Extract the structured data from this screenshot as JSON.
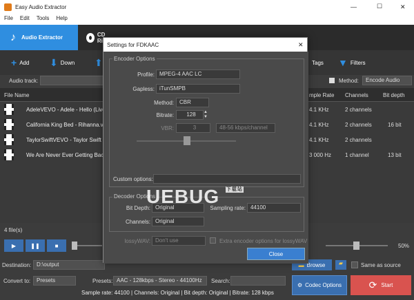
{
  "window": {
    "title": "Easy Audio Extractor",
    "minimize": "—",
    "maximize": "☐",
    "close": "✕"
  },
  "menu": [
    "File",
    "Edit",
    "Tools",
    "Help"
  ],
  "tabs": {
    "audio_extractor": "Audio Extractor",
    "cd_ripper": "CD Ri"
  },
  "toolbar": {
    "add": "Add",
    "down": "Down",
    "tags": "Tags",
    "filters": "Filters"
  },
  "audio_track": {
    "label": "Audio track:"
  },
  "method": {
    "label": "Method:",
    "value": "Encode Audio"
  },
  "table": {
    "headers": {
      "file_name": "File Name",
      "sample_rate": "mple Rate",
      "channels": "Channels",
      "bit_depth": "Bit depth"
    },
    "rows": [
      {
        "name": "AdeleVEVO - Adele - Hello (Live",
        "sample_rate": "4.1 KHz",
        "channels": "2 channels",
        "bit_depth": ""
      },
      {
        "name": "California King Bed - Rihanna.v",
        "sample_rate": "4.1 KHz",
        "channels": "2 channels",
        "bit_depth": "16 bit"
      },
      {
        "name": "TaylorSwiftVEVO - Taylor Swift -",
        "sample_rate": "4.1 KHz",
        "channels": "2 channels",
        "bit_depth": ""
      },
      {
        "name": "We Are Never Ever Getting Back",
        "sample_rate": "3 000 Hz",
        "channels": "1 channel",
        "bit_depth": "13 bit"
      }
    ]
  },
  "file_count": "4 file(s)",
  "volume_percent": "50%",
  "destination": {
    "label": "Destination:",
    "value": "D:\\output",
    "browse": "Browse",
    "same_as_source": "Same as source"
  },
  "convert_to": {
    "label": "Convert to:",
    "value": "Presets"
  },
  "presets": {
    "label": "Presets:",
    "value": "AAC - 128kbps - Stereo - 44100Hz"
  },
  "search": {
    "label": "Search:"
  },
  "codec_options": "Codec Options",
  "start": "Start",
  "status": "Sample rate: 44100 | Channels: Original | Bit depth: Original | Bitrate: 128 kbps",
  "dialog": {
    "title": "Settings for  FDKAAC",
    "close": "✕",
    "encoder_group": "Encoder Options",
    "profile_label": "Profile:",
    "profile": "MPEG-4 AAC LC",
    "gapless_label": "Gapless:",
    "gapless": "iTunSMPB",
    "method_label": "Method:",
    "method": "CBR",
    "bitrate_label": "Bitrate:",
    "bitrate": "128",
    "vbr_label": "VBR:",
    "vbr": "3",
    "vbr_info": "48-56 kbps/channel",
    "custom_label": "Custom options:",
    "decoder_group": "Decoder Options",
    "bit_depth_label": "Bit Depth:",
    "bit_depth": "Original",
    "sampling_rate_label": "Sampling rate:",
    "sampling_rate": "44100",
    "channels_label": "Channels:",
    "channels": "Original",
    "lossywav_label": "lossyWAV:",
    "lossywav": "Don't use",
    "extra_label": "Extra encoder options for lossyWAV",
    "close_button": "Close"
  },
  "watermark": {
    "text": "UEBUG",
    "sub": "下载站"
  }
}
